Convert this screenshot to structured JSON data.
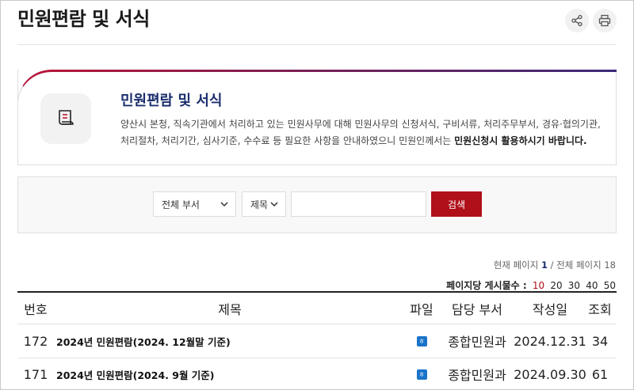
{
  "page_title": "민원편람 및 서식",
  "tools": {
    "share_icon": "share-icon",
    "print_icon": "print-icon"
  },
  "intro": {
    "icon": "document-icon",
    "heading": "민원편람 및 서식",
    "text": "양산시 본청, 직속기관에서 처리하고 있는 민원사무에 대해 민원사무의 신청서식, 구비서류, 처리주무부서, 경유·협의기관, 처리절차, 처리기간, 심사기준, 수수료 등 필요한 사항을 안내하였으니 민원인께서는 ",
    "text_bold": "민원신청시 활용하시기 바랍니다."
  },
  "search": {
    "dept_selected": "전체 부서",
    "field_selected": "제목",
    "query_value": "",
    "button_label": "검색"
  },
  "pagination": {
    "current_label": "현재 페이지",
    "current": "1",
    "separator": " / ",
    "total_label": "전체 페이지",
    "total": "18"
  },
  "per_page": {
    "label": "페이지당 게시물수 :",
    "options": [
      "10",
      "20",
      "30",
      "40",
      "50"
    ],
    "active": "10"
  },
  "table": {
    "headers": {
      "no": "번호",
      "title": "제목",
      "file": "파일",
      "dept": "담당 부서",
      "date": "작성일",
      "views": "조회"
    },
    "rows": [
      {
        "no": "172",
        "title": "2024년 민원편람(2024. 12월말 기준)",
        "file_icon": "hwp-file-icon",
        "dept": "종합민원과",
        "date": "2024.12.31",
        "views": "34"
      },
      {
        "no": "171",
        "title": "2024년 민원편람(2024. 9월 기준)",
        "file_icon": "hwp-file-icon",
        "dept": "종합민원과",
        "date": "2024.09.30",
        "views": "61"
      }
    ]
  },
  "colors": {
    "accent_red": "#b0101a",
    "heading_navy": "#1c2f6e",
    "file_blue": "#1a73c9"
  }
}
